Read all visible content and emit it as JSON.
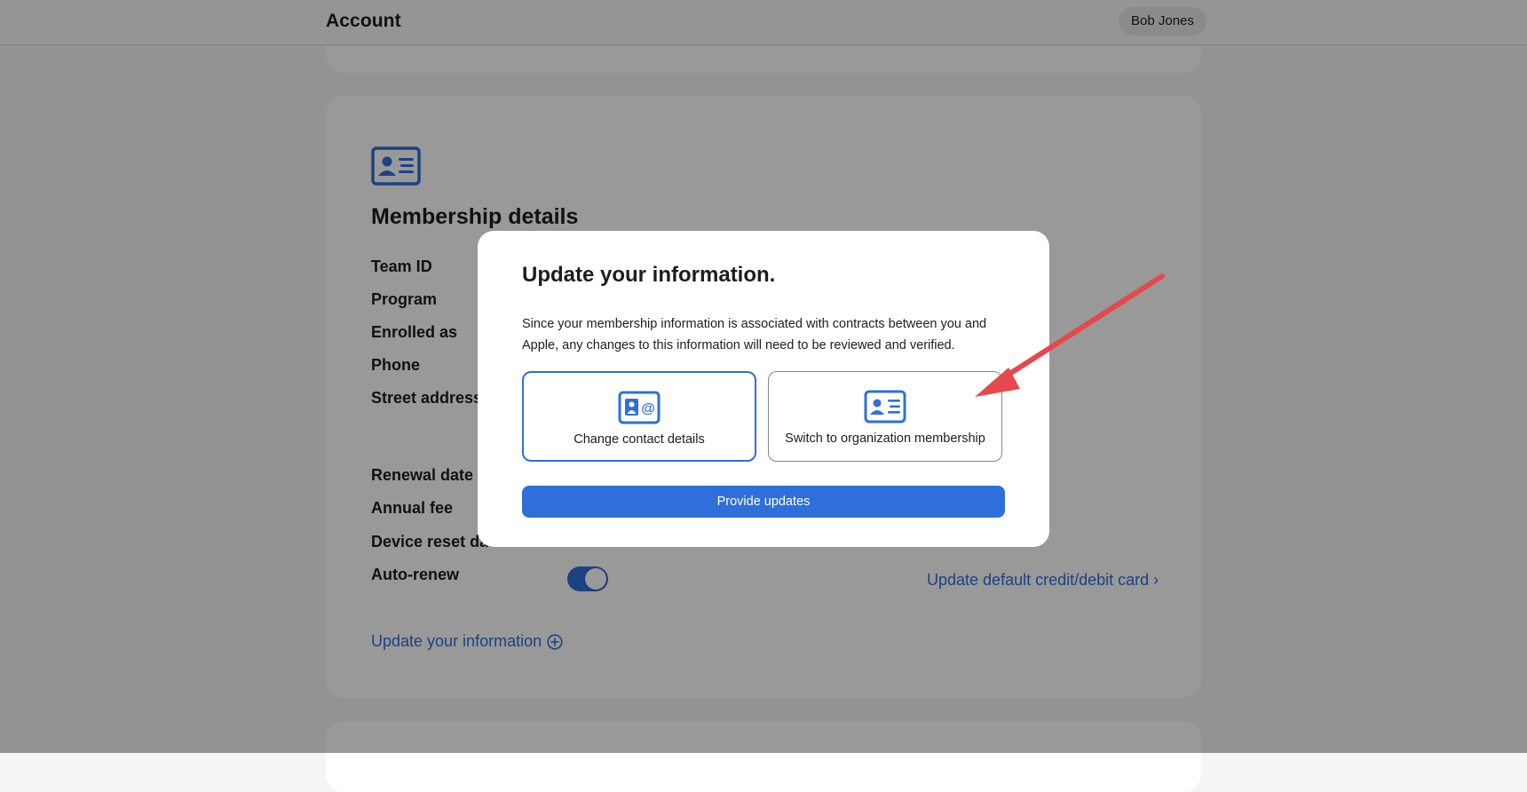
{
  "header": {
    "title": "Account",
    "user_name": "Bob Jones"
  },
  "membership": {
    "title": "Membership details",
    "fields": {
      "team_id": "Team ID",
      "program": "Program",
      "enrolled_as": "Enrolled as",
      "phone": "Phone",
      "street_address": "Street address",
      "renewal_date": "Renewal date",
      "annual_fee": "Annual fee",
      "device_reset_date": "Device reset date",
      "auto_renew": "Auto-renew"
    },
    "auto_renew_on": true,
    "credit_card_link": "Update default credit/debit card ›",
    "update_link": "Update your information"
  },
  "modal": {
    "title": "Update your information.",
    "description": "Since your membership information is associated with contracts between you and Apple, any changes to this information will need to be reviewed and verified.",
    "options": [
      {
        "label": "Change contact details",
        "icon": "contact-card-at-icon",
        "selected": true
      },
      {
        "label": "Switch to organization membership",
        "icon": "id-card-icon",
        "selected": false
      }
    ],
    "primary_button": "Provide updates"
  },
  "colors": {
    "accent": "#2f6fd9",
    "annotation_arrow": "#e5484d"
  }
}
